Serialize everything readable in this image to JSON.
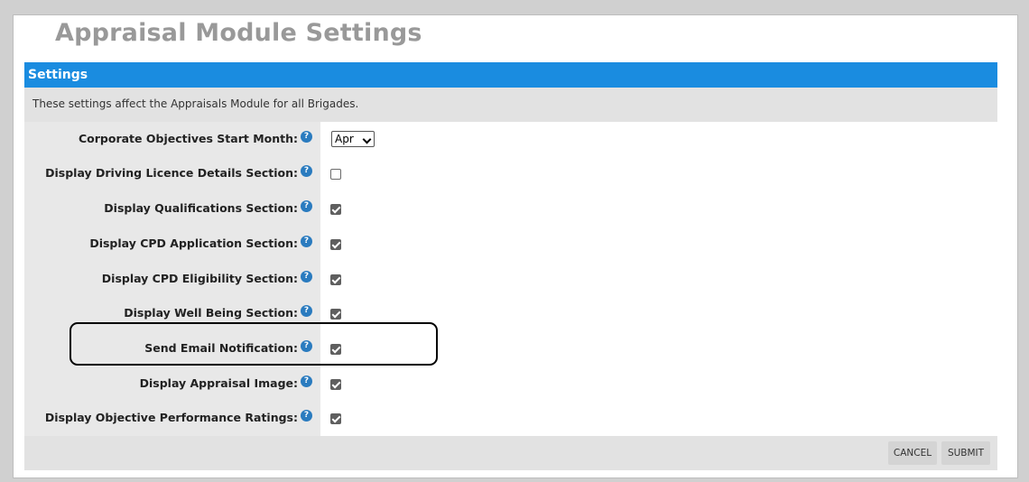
{
  "page": {
    "title": "Appraisal Module Settings"
  },
  "section": {
    "title": "Settings",
    "description": "These settings affect the Appraisals Module for all Brigades."
  },
  "settings": [
    {
      "label": "Corporate Objectives Start Month:",
      "type": "select",
      "value": "Apr"
    },
    {
      "label": "Display Driving Licence Details Section:",
      "type": "checkbox",
      "checked": false
    },
    {
      "label": "Display Qualifications Section:",
      "type": "checkbox",
      "checked": true
    },
    {
      "label": "Display CPD Application Section:",
      "type": "checkbox",
      "checked": true
    },
    {
      "label": "Display CPD Eligibility Section:",
      "type": "checkbox",
      "checked": true
    },
    {
      "label": "Display Well Being Section:",
      "type": "checkbox",
      "checked": true
    },
    {
      "label": "Send Email Notification:",
      "type": "checkbox",
      "checked": true
    },
    {
      "label": "Display Appraisal Image:",
      "type": "checkbox",
      "checked": true
    },
    {
      "label": "Display Objective Performance Ratings:",
      "type": "checkbox",
      "checked": true
    }
  ],
  "help_icon_glyph": "?",
  "footer": {
    "cancel_label": "CANCEL",
    "submit_label": "SUBMIT"
  },
  "colors": {
    "accent": "#1a8ce0",
    "title_gray": "#999999",
    "checkbox_checked": "#5f5f5f"
  }
}
